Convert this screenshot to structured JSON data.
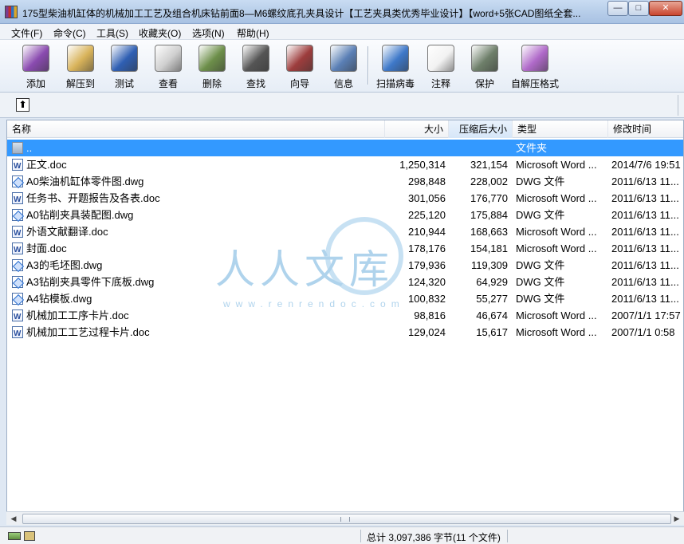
{
  "window": {
    "title": "175型柴油机缸体的机械加工工艺及组合机床钻前面8—M6螺纹底孔夹具设计【工艺夹具类优秀毕业设计】【word+5张CAD图纸全套...",
    "minimize": "—",
    "maximize": "□",
    "close": "✕"
  },
  "menu": [
    "文件(F)",
    "命令(C)",
    "工具(S)",
    "收藏夹(O)",
    "选项(N)",
    "帮助(H)"
  ],
  "toolbar": [
    {
      "label": "添加",
      "icon": "add-archive-icon",
      "color": "#8a4bb0"
    },
    {
      "label": "解压到",
      "icon": "extract-to-icon",
      "color": "#d8b35a"
    },
    {
      "label": "测试",
      "icon": "test-icon",
      "color": "#2f5fb3"
    },
    {
      "label": "查看",
      "icon": "view-icon",
      "color": "#cfcfcf"
    },
    {
      "label": "删除",
      "icon": "delete-icon",
      "color": "#6d8f4a"
    },
    {
      "label": "查找",
      "icon": "find-icon",
      "color": "#555555"
    },
    {
      "label": "向导",
      "icon": "wizard-icon",
      "color": "#9d3d3d"
    },
    {
      "label": "信息",
      "icon": "info-icon",
      "color": "#5a7fb5"
    },
    {
      "label": "扫描病毒",
      "icon": "scan-virus-icon",
      "color": "#3e78c9"
    },
    {
      "label": "注释",
      "icon": "comment-icon",
      "color": "#f2f2f2"
    },
    {
      "label": "保护",
      "icon": "protect-icon",
      "color": "#6e7f6a"
    },
    {
      "label": "自解压格式",
      "icon": "sfx-icon",
      "color": "#b06ac9"
    }
  ],
  "path": {
    "up_glyph": "⬆"
  },
  "columns": {
    "name": "名称",
    "size": "大小",
    "packed": "压缩后大小",
    "type": "类型",
    "modified": "修改时间"
  },
  "files": [
    {
      "name": "..",
      "size": "",
      "packed": "",
      "type": "文件夹",
      "modified": "",
      "kind": "folder"
    },
    {
      "name": "正文.doc",
      "size": "1,250,314",
      "packed": "321,154",
      "type": "Microsoft Word ...",
      "modified": "2014/7/6 19:51",
      "kind": "word"
    },
    {
      "name": "A0柴油机缸体零件图.dwg",
      "size": "298,848",
      "packed": "228,002",
      "type": "DWG 文件",
      "modified": "2011/6/13 11...",
      "kind": "dwg"
    },
    {
      "name": "任务书、开题报告及各表.doc",
      "size": "301,056",
      "packed": "176,770",
      "type": "Microsoft Word ...",
      "modified": "2011/6/13 11...",
      "kind": "word"
    },
    {
      "name": "A0钻削夹具装配图.dwg",
      "size": "225,120",
      "packed": "175,884",
      "type": "DWG 文件",
      "modified": "2011/6/13 11...",
      "kind": "dwg"
    },
    {
      "name": "外语文献翻译.doc",
      "size": "210,944",
      "packed": "168,663",
      "type": "Microsoft Word ...",
      "modified": "2011/6/13 11...",
      "kind": "word"
    },
    {
      "name": "封面.doc",
      "size": "178,176",
      "packed": "154,181",
      "type": "Microsoft Word ...",
      "modified": "2011/6/13 11...",
      "kind": "word"
    },
    {
      "name": "A3的毛坯图.dwg",
      "size": "179,936",
      "packed": "119,309",
      "type": "DWG 文件",
      "modified": "2011/6/13 11...",
      "kind": "dwg"
    },
    {
      "name": "A3钻削夹具零件下底板.dwg",
      "size": "124,320",
      "packed": "64,929",
      "type": "DWG 文件",
      "modified": "2011/6/13 11...",
      "kind": "dwg"
    },
    {
      "name": "A4钻模板.dwg",
      "size": "100,832",
      "packed": "55,277",
      "type": "DWG 文件",
      "modified": "2011/6/13 11...",
      "kind": "dwg"
    },
    {
      "name": "机械加工工序卡片.doc",
      "size": "98,816",
      "packed": "46,674",
      "type": "Microsoft Word ...",
      "modified": "2007/1/1 17:57",
      "kind": "word"
    },
    {
      "name": "机械加工工艺过程卡片.doc",
      "size": "129,024",
      "packed": "15,617",
      "type": "Microsoft Word ...",
      "modified": "2007/1/1 0:58",
      "kind": "word"
    }
  ],
  "status": {
    "summary": "总计 3,097,386 字节(11 个文件)"
  },
  "watermark": {
    "text": "人人文库",
    "url": "www.renrendoc.com"
  },
  "colors": {
    "selection": "#3399ff",
    "title_gradient_top": "#c9dcf2"
  }
}
